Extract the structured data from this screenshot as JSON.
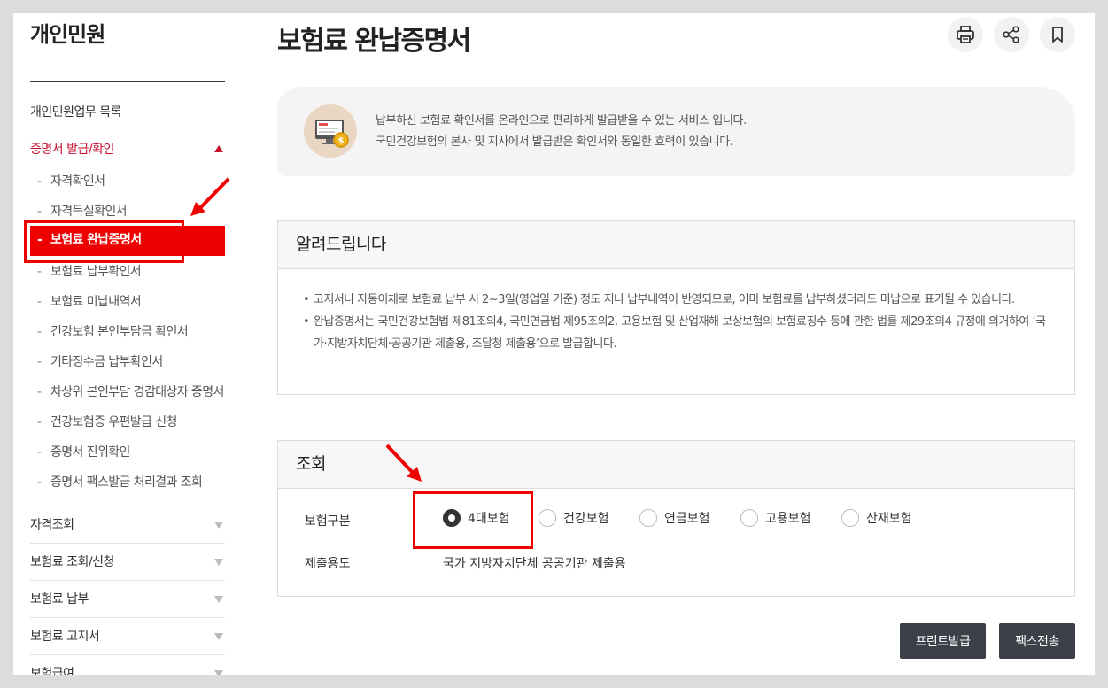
{
  "sidebar": {
    "title": "개인민원",
    "top_link": "개인민원업무 목록",
    "active_group": "증명서 발급/확인",
    "items": [
      {
        "label": "자격확인서"
      },
      {
        "label": "자격득실확인서"
      },
      {
        "label": "보험료 완납증명서"
      },
      {
        "label": "보험료 납부확인서"
      },
      {
        "label": "보험료 미납내역서"
      },
      {
        "label": "건강보험 본인부담금 확인서"
      },
      {
        "label": "기타징수금 납부확인서"
      },
      {
        "label": "차상위 본인부담 경감대상자 증명서"
      },
      {
        "label": "건강보험증 우편발급 신청"
      },
      {
        "label": "증명서 진위확인"
      },
      {
        "label": "증명서 팩스발급 처리결과 조회"
      }
    ],
    "dash": "-",
    "groups": [
      {
        "label": "자격조회"
      },
      {
        "label": "보험료 조회/신청"
      },
      {
        "label": "보험료 납부"
      },
      {
        "label": "보험료 고지서"
      },
      {
        "label": "보험급여"
      }
    ]
  },
  "page": {
    "title": "보험료 완납증명서"
  },
  "toolbar": {
    "print_icon": "print-icon",
    "share_icon": "share-icon",
    "bookmark_icon": "bookmark-icon"
  },
  "intro": {
    "line1": "납부하신 보험료 확인서를 온라인으로 편리하게 발급받을 수 있는 서비스 입니다.",
    "line2": "국민건강보험의 본사 및 지사에서 발급받은 확인서와 동일한 효력이 있습니다."
  },
  "notice": {
    "heading": "알려드립니다",
    "items": [
      "고지서나 자동이체로 보험료 납부 시 2~3일(영업일 기준) 정도 지나 납부내역이 반영되므로, 이미 보험료를 납부하셨더라도 미납으로 표기될 수 있습니다.",
      "완납증명서는 국민건강보험법 제81조의4, 국민연금법 제95조의2, 고용보험 및 산업재해 보상보험의 보험료징수 등에 관한 법률 제29조의4 규정에 의거하여 ‘국가·지방자치단체·공공기관 제출용, 조달청 제출용’으로 발급합니다."
    ]
  },
  "query": {
    "heading": "조회",
    "insurance_label": "보험구분",
    "options": [
      {
        "label": "4대보험",
        "checked": true
      },
      {
        "label": "건강보험",
        "checked": false
      },
      {
        "label": "연금보험",
        "checked": false
      },
      {
        "label": "고용보험",
        "checked": false
      },
      {
        "label": "산재보험",
        "checked": false
      }
    ],
    "purpose_label": "제출용도",
    "purpose_value": "국가 지방자치단체 공공기관 제출용"
  },
  "buttons": {
    "print": "프린트발급",
    "fax": "팩스전송"
  },
  "colors": {
    "accent_red": "#c8102e",
    "highlight_red": "#ee0000",
    "button_dark": "#3c4049"
  }
}
